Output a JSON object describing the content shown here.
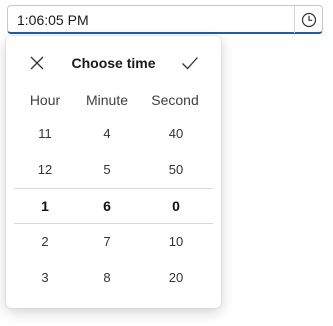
{
  "input": {
    "value": "1:06:05 PM",
    "clock_icon": "clock-icon"
  },
  "picker": {
    "title": "Choose time",
    "close_icon": "close-icon",
    "confirm_icon": "checkmark-icon",
    "columns": [
      "Hour",
      "Minute",
      "Second"
    ],
    "hours": [
      "11",
      "12",
      "1",
      "2",
      "3"
    ],
    "minutes": [
      "4",
      "5",
      "6",
      "7",
      "8"
    ],
    "seconds": [
      "40",
      "50",
      "0",
      "10",
      "20"
    ],
    "selected": {
      "hour": "1",
      "minute": "6",
      "second": "0"
    }
  },
  "colors": {
    "accent": "#1b5fb0"
  }
}
